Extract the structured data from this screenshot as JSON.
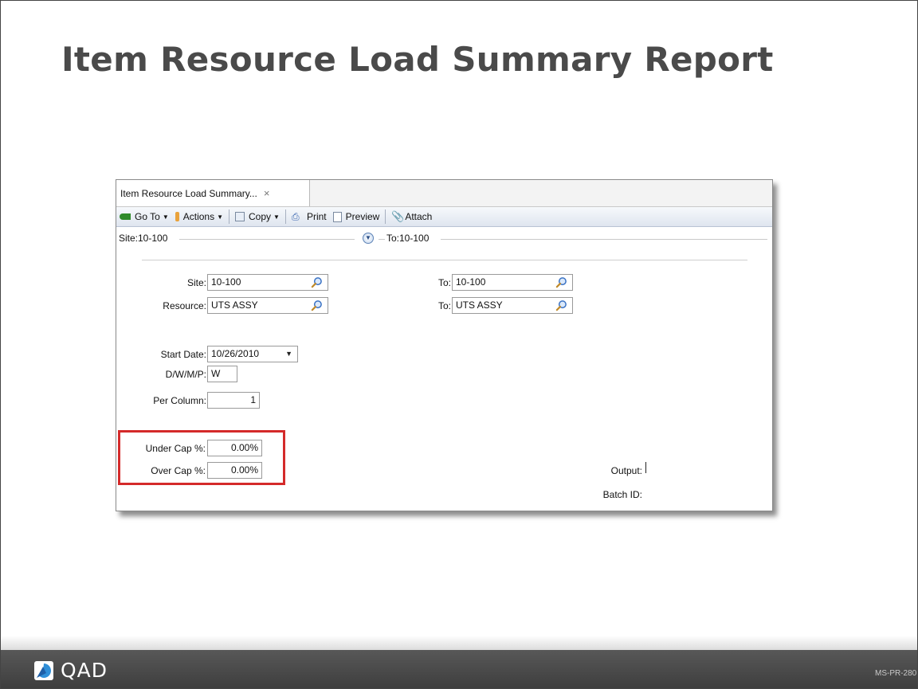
{
  "slide": {
    "title": "Item Resource Load Summary Report",
    "code": "MS-PR-280"
  },
  "window": {
    "tab_label": "Item Resource Load Summary...",
    "tab_close": "×",
    "toolbar": {
      "goto": "Go To",
      "actions": "Actions",
      "copy": "Copy",
      "print": "Print",
      "preview": "Preview",
      "attach": "Attach",
      "dropdown_arrow": "▼"
    },
    "sitebar": {
      "from": "Site:10-100",
      "to": "To:10-100",
      "collapse_icon": "▼"
    },
    "form": {
      "site_label": "Site:",
      "site_value": "10-100",
      "site_to_label": "To:",
      "site_to_value": "10-100",
      "resource_label": "Resource:",
      "resource_value": "UTS ASSY",
      "resource_to_label": "To:",
      "resource_to_value": "UTS ASSY",
      "start_date_label": "Start Date:",
      "start_date_value": "10/26/2010",
      "start_date_arrow": "▼",
      "dwmp_label": "D/W/M/P:",
      "dwmp_value": "W",
      "per_column_label": "Per Column:",
      "per_column_value": "1",
      "under_cap_label": "Under Cap %:",
      "under_cap_value": "0.00%",
      "over_cap_label": "Over Cap %:",
      "over_cap_value": "0.00%",
      "output_label": "Output:",
      "batch_id_label": "Batch ID:"
    }
  },
  "footer": {
    "logo_text": "QAD"
  },
  "colors": {
    "highlight": "#d42a2a",
    "footer_bg": "#4a4a4a",
    "title": "#4a4a4a"
  }
}
